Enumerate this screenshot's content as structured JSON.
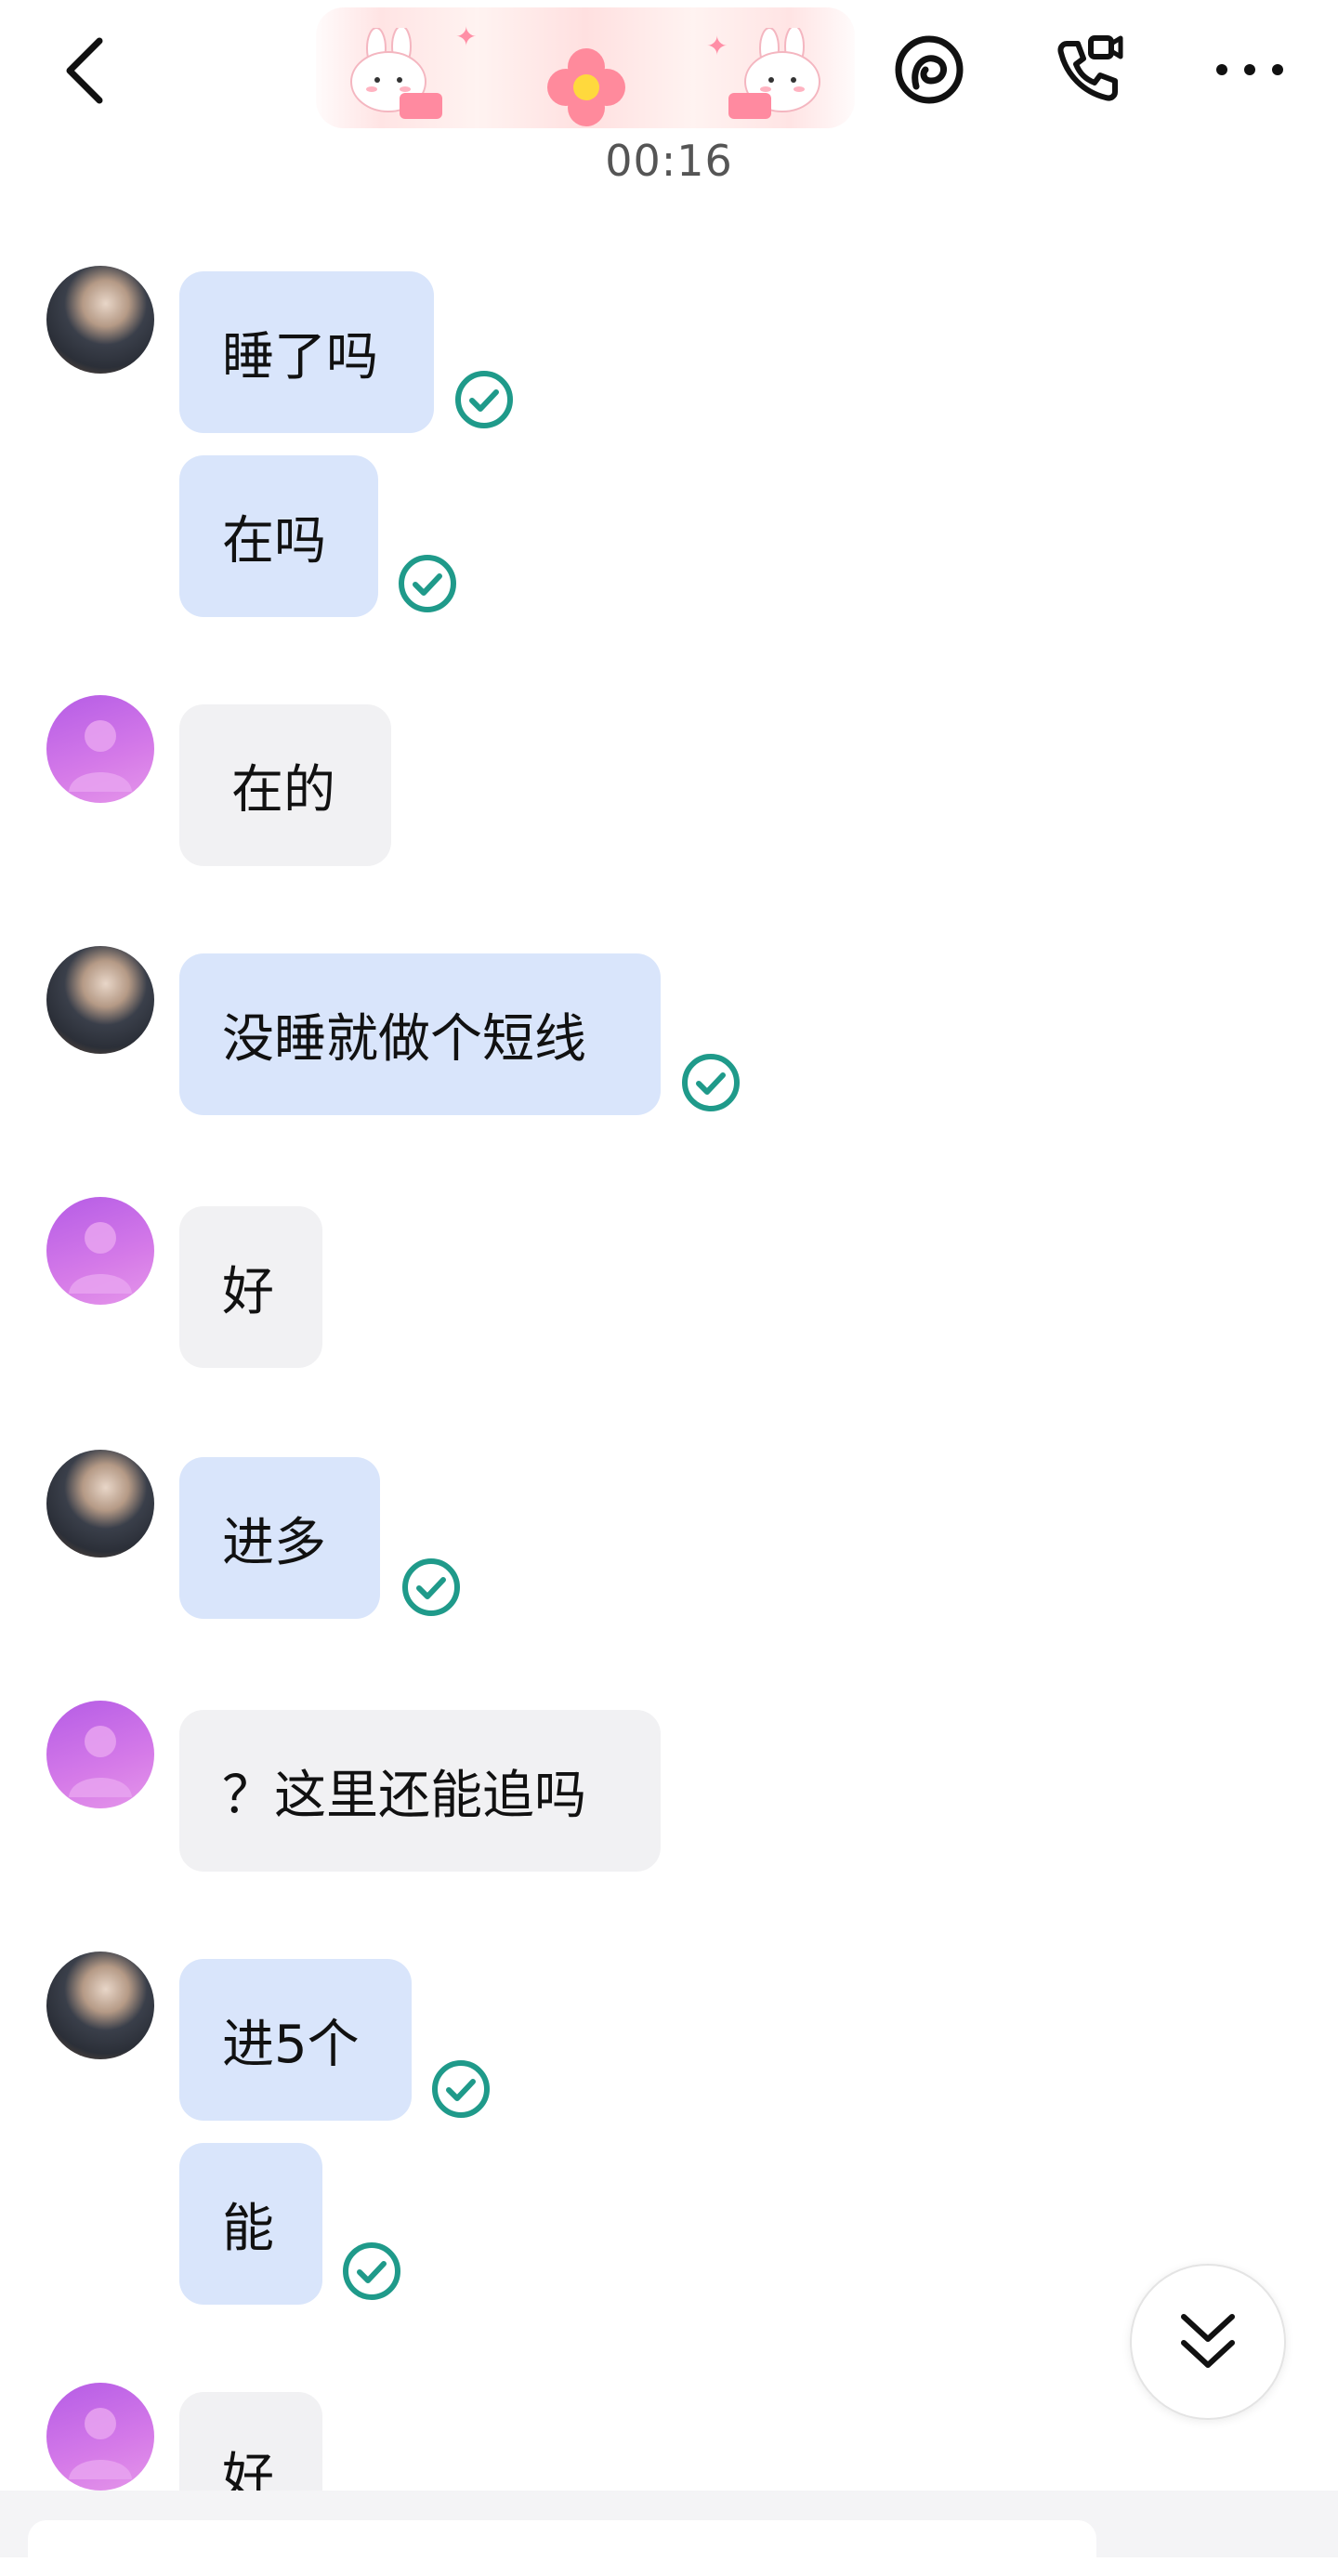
{
  "header": {
    "time": "00:16",
    "back_icon": "chevron-left-icon",
    "icons": [
      "sticker-circle-icon",
      "call-icon",
      "more-icon"
    ]
  },
  "messages": [
    {
      "sender": "me",
      "text": "睡了吗",
      "status": "read"
    },
    {
      "sender": "me",
      "text": "在吗",
      "status": "read"
    },
    {
      "sender": "other",
      "text": "在的"
    },
    {
      "sender": "me",
      "text": "没睡就做个短线",
      "status": "read"
    },
    {
      "sender": "other",
      "text": "好"
    },
    {
      "sender": "me",
      "text": "进多",
      "status": "read"
    },
    {
      "sender": "other",
      "text": "？这里还能追吗"
    },
    {
      "sender": "me",
      "text": "进5个",
      "status": "read"
    },
    {
      "sender": "me",
      "text": "能",
      "status": "read"
    },
    {
      "sender": "other",
      "text": "好"
    }
  ],
  "colors": {
    "mine_bubble": "#d9e5fb",
    "their_bubble": "#f1f1f3",
    "read_check": "#1f9a8a"
  },
  "scroll_button_icon": "double-chevron-down-icon"
}
